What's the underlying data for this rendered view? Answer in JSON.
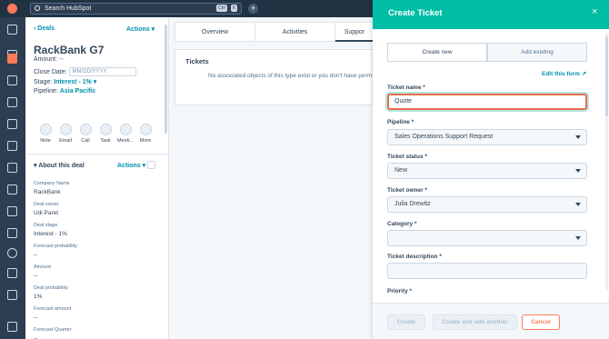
{
  "topbar": {
    "search_placeholder": "Search HubSpot",
    "shortcut_ctrl": "Ctrl",
    "shortcut_key": "K"
  },
  "sidebar": {
    "back_label": "Deals",
    "actions_label": "Actions",
    "deal_name": "RackBank G7",
    "amount_label": "Amount: --",
    "close_date_label": "Close Date:",
    "close_date_placeholder": "MM/DD/YYYY",
    "stage_label": "Stage:",
    "stage_value": "Interest - 1%",
    "pipeline_label": "Pipeline:",
    "pipeline_value": "Asia Pacific",
    "activity_buttons": [
      "Note",
      "Email",
      "Call",
      "Task",
      "Meeti...",
      "More"
    ],
    "about_title": "About this deal",
    "about_actions": "Actions",
    "properties": [
      {
        "label": "Company Name",
        "value": "RackBank"
      },
      {
        "label": "Deal owner",
        "value": "Udi Paret"
      },
      {
        "label": "Deal stage",
        "value": "Interest - 1%"
      },
      {
        "label": "Forecast probability",
        "value": "--"
      },
      {
        "label": "Amount",
        "value": "--"
      },
      {
        "label": "Deal probability",
        "value": "1%"
      },
      {
        "label": "Forecast amount",
        "value": "--"
      },
      {
        "label": "Forecast Quarter",
        "value": "--"
      }
    ]
  },
  "main": {
    "tabs": [
      "Overview",
      "Activities",
      "Suppor"
    ],
    "card_title": "Tickets",
    "card_empty": "No associated objects of this type exist or you don't have perm"
  },
  "panel": {
    "title": "Create Ticket",
    "close_icon": "×",
    "tab_create": "Create new",
    "tab_existing": "Add existing",
    "edit_form": "Edit this form",
    "fields": {
      "ticket_name_label": "Ticket name *",
      "ticket_name_value": "Quote",
      "pipeline_label": "Pipeline *",
      "pipeline_value": "Sales Operations Support Request",
      "status_label": "Ticket status *",
      "status_value": "New",
      "owner_label": "Ticket owner *",
      "owner_value": "Julia Drewitz",
      "category_label": "Category *",
      "category_value": "",
      "description_label": "Ticket description *",
      "description_value": "",
      "priority_label": "Priority *"
    },
    "buttons": {
      "create": "Create",
      "create_another": "Create and add another",
      "cancel": "Cancel"
    }
  }
}
